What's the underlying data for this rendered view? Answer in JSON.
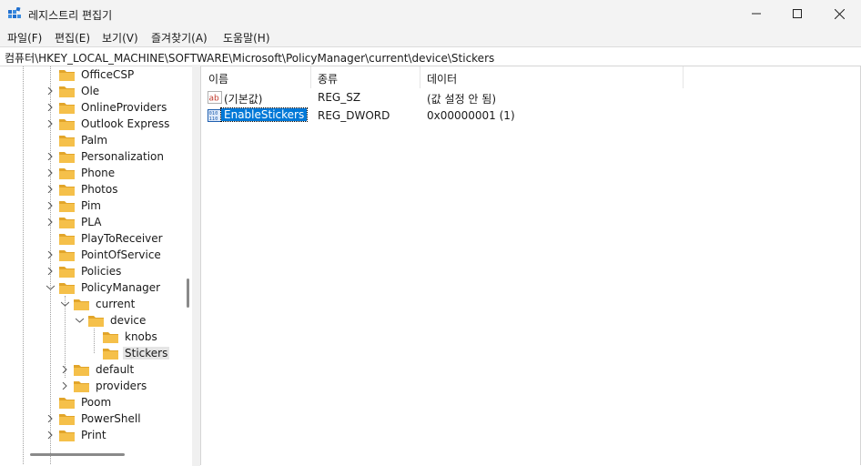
{
  "window": {
    "title": "레지스트리 편집기",
    "icon": "registry-editor-icon",
    "controls": [
      "minimize-icon",
      "maximize-icon",
      "close-icon"
    ]
  },
  "menu": [
    "파일(F)",
    "편집(E)",
    "보기(V)",
    "즐겨찾기(A)",
    "도움말(H)"
  ],
  "address": "컴퓨터\\HKEY_LOCAL_MACHINE\\SOFTWARE\\Microsoft\\PolicyManager\\current\\device\\Stickers",
  "tree": [
    {
      "label": "OfficeCSP",
      "expander": "none"
    },
    {
      "label": "Ole",
      "expander": "collapsed"
    },
    {
      "label": "OnlineProviders",
      "expander": "collapsed"
    },
    {
      "label": "Outlook Express",
      "expander": "collapsed"
    },
    {
      "label": "Palm",
      "expander": "none"
    },
    {
      "label": "Personalization",
      "expander": "collapsed"
    },
    {
      "label": "Phone",
      "expander": "collapsed"
    },
    {
      "label": "Photos",
      "expander": "collapsed"
    },
    {
      "label": "Pim",
      "expander": "collapsed"
    },
    {
      "label": "PLA",
      "expander": "collapsed"
    },
    {
      "label": "PlayToReceiver",
      "expander": "none"
    },
    {
      "label": "PointOfService",
      "expander": "collapsed"
    },
    {
      "label": "Policies",
      "expander": "collapsed"
    },
    {
      "label": "PolicyManager",
      "expander": "expanded"
    },
    {
      "label": "current",
      "expander": "expanded"
    },
    {
      "label": "device",
      "expander": "expanded"
    },
    {
      "label": "knobs",
      "expander": "none"
    },
    {
      "label": "Stickers",
      "expander": "none",
      "selected": true
    },
    {
      "label": "default",
      "expander": "collapsed"
    },
    {
      "label": "providers",
      "expander": "collapsed"
    },
    {
      "label": "Poom",
      "expander": "none"
    },
    {
      "label": "PowerShell",
      "expander": "collapsed"
    },
    {
      "label": "Print",
      "expander": "collapsed"
    }
  ],
  "list": {
    "columns": [
      "이름",
      "종류",
      "데이터"
    ],
    "rows": [
      {
        "icon": "string-value-icon",
        "name": "(기본값)",
        "type": "REG_SZ",
        "data": "(값 설정 안 됨)"
      },
      {
        "icon": "binary-value-icon",
        "name": "EnableStickers",
        "type": "REG_DWORD",
        "data": "0x00000001 (1)",
        "selected": true
      }
    ]
  },
  "colors": {
    "selection": "#0078d7",
    "folder": "#f5c04a",
    "folder_dark": "#e2a52a",
    "chrome": "#f3f3f3"
  }
}
